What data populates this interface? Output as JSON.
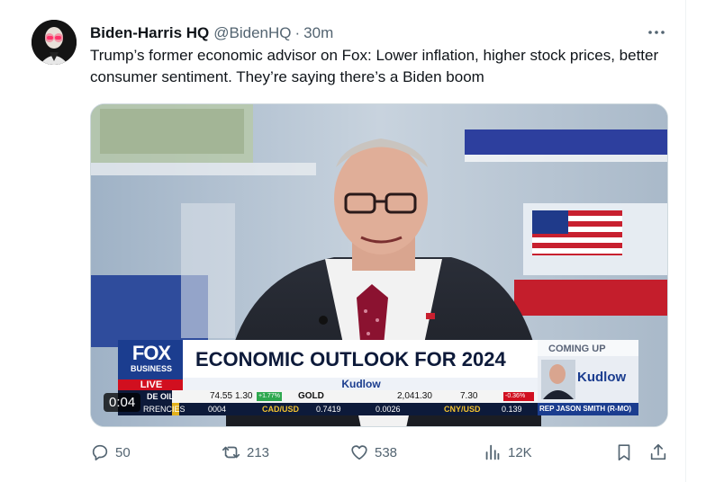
{
  "tweet": {
    "author_name": "Biden-Harris HQ",
    "author_handle": "@BidenHQ",
    "separator": "·",
    "time": "30m",
    "text": "Trump’s former economic advisor on Fox: Lower inflation, higher stock prices, better consumer sentiment. They’re saying there’s a Biden boom"
  },
  "video": {
    "duration": "0:04",
    "chyron": {
      "network_top": "FOX",
      "network_bottom": "BUSINESS",
      "live": "LIVE",
      "headline": "ECONOMIC OUTLOOK FOR 2024",
      "show": "Kudlow",
      "coming_up": "COMING UP",
      "coming_show": "Kudlow",
      "guest": "REP JASON SMITH (R-MO)",
      "ticker_row1": [
        {
          "label": "DE OIL",
          "value": "74.55",
          "change": "1.30",
          "pct": "+1.77%"
        },
        {
          "label": "GOLD",
          "value": "2,041.30",
          "change": "7.30",
          "pct": "-0.36%"
        }
      ],
      "ticker_row2": [
        {
          "label": "RRENCIES",
          "value": "0004"
        },
        {
          "label": "CAD/USD",
          "value": "0.7419",
          "change": "0.0026"
        },
        {
          "label": "CNY/USD",
          "value": "0.139"
        }
      ]
    }
  },
  "actions": {
    "replies": "50",
    "retweets": "213",
    "likes": "538",
    "views": "12K"
  },
  "icons": {
    "more": "more-icon",
    "reply": "reply-icon",
    "retweet": "retweet-icon",
    "like": "heart-icon",
    "views": "views-icon",
    "bookmark": "bookmark-icon",
    "share": "share-icon"
  },
  "colors": {
    "text_primary": "#0f1419",
    "text_secondary": "#536471",
    "fox_blue": "#1b3d8f",
    "live_red": "#d10f1f"
  }
}
